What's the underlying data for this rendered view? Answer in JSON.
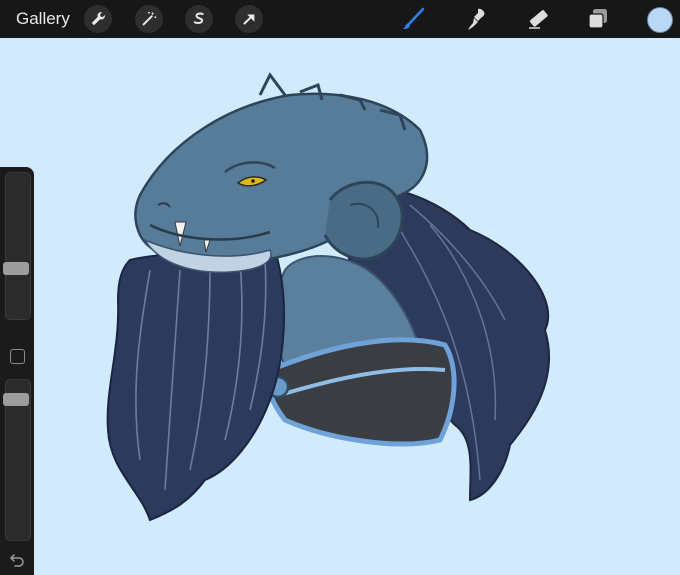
{
  "topbar": {
    "gallery_label": "Gallery",
    "left_tools": [
      "wrench-icon",
      "magic-wand-icon",
      "selection-icon",
      "transform-arrow-icon"
    ],
    "right_tools": [
      "brush-icon",
      "smudge-icon",
      "eraser-icon",
      "layers-icon"
    ],
    "active_tool": "brush-icon",
    "current_color": "#b9d8f6"
  },
  "canvas": {
    "background_color": "#d2ebfc",
    "artwork": "dragon-bust-illustration"
  },
  "sidebar": {
    "brush_size_level": 0.5,
    "opacity_level": 0.95,
    "modify_button": "square-icon",
    "undo_icon": "undo-icon"
  }
}
